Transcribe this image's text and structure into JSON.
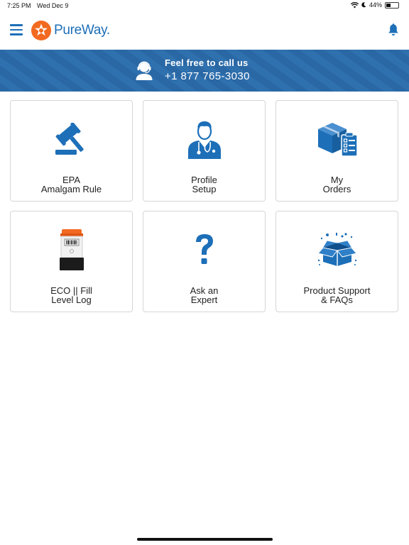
{
  "status_bar": {
    "time": "7:25 PM",
    "date": "Wed Dec 9",
    "battery": "44%",
    "battery_level": 0.44
  },
  "header": {
    "logo_text": "PureWay."
  },
  "banner": {
    "line1": "Feel free to call us",
    "phone": "+1 877 765-3030"
  },
  "tiles": [
    {
      "line1": "EPA",
      "line2": "Amalgam Rule",
      "icon": "gavel-icon"
    },
    {
      "line1": "Profile",
      "line2": "Setup",
      "icon": "doctor-icon"
    },
    {
      "line1": "My",
      "line2": "Orders",
      "icon": "orders-box-icon"
    },
    {
      "line1": "ECO || Fill",
      "line2": "Level Log",
      "icon": "container-icon"
    },
    {
      "line1": "Ask an",
      "line2": "Expert",
      "icon": "question-mark-icon"
    },
    {
      "line1": "Product Support",
      "line2": "& FAQs",
      "icon": "open-box-icon"
    }
  ],
  "colors": {
    "brand_blue": "#1d6fb8",
    "banner_blue": "#2a68a5",
    "logo_orange": "#f26a21"
  }
}
